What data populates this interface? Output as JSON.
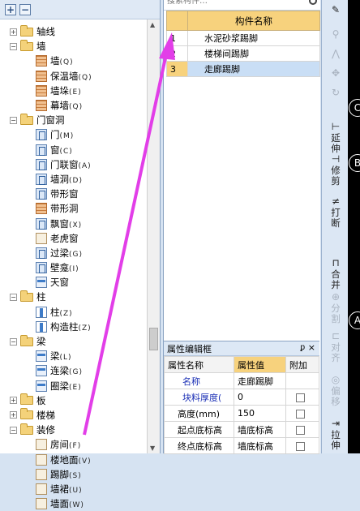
{
  "tree": {
    "add_label": "+",
    "remove_label": "−",
    "nodes": [
      {
        "label": "轴线",
        "type": "folder",
        "expander": "▹",
        "level": 0
      },
      {
        "label": "墙",
        "type": "folder-open",
        "expander": "◢",
        "level": 0
      },
      {
        "label": "墙",
        "key": "(Q)",
        "type": "wall",
        "level": 1
      },
      {
        "label": "保温墙",
        "key": "(Q)",
        "type": "wall",
        "level": 1
      },
      {
        "label": "墙垛",
        "key": "(E)",
        "type": "wall",
        "level": 1
      },
      {
        "label": "幕墙",
        "key": "(Q)",
        "type": "wall",
        "level": 1
      },
      {
        "label": "门窗洞",
        "type": "folder-open",
        "expander": "◢",
        "level": 0
      },
      {
        "label": "门",
        "key": "(M)",
        "type": "door",
        "level": 1
      },
      {
        "label": "窗",
        "key": "(C)",
        "type": "door",
        "level": 1
      },
      {
        "label": "门联窗",
        "key": "(A)",
        "type": "door",
        "level": 1
      },
      {
        "label": "墙洞",
        "key": "(D)",
        "type": "door",
        "level": 1
      },
      {
        "label": "带形窗",
        "key": "",
        "type": "door",
        "level": 1
      },
      {
        "label": "带形洞",
        "key": "",
        "type": "wall",
        "level": 1
      },
      {
        "label": "飘窗",
        "key": "(X)",
        "type": "door",
        "level": 1
      },
      {
        "label": "老虎窗",
        "key": "",
        "type": "room",
        "level": 1
      },
      {
        "label": "过梁",
        "key": "(G)",
        "type": "door",
        "level": 1
      },
      {
        "label": "壁龛",
        "key": "(I)",
        "type": "door",
        "level": 1
      },
      {
        "label": "天窗",
        "key": "",
        "type": "beam",
        "level": 1
      },
      {
        "label": "柱",
        "type": "folder-open",
        "expander": "◢",
        "level": 0
      },
      {
        "label": "柱",
        "key": "(Z)",
        "type": "col",
        "level": 1
      },
      {
        "label": "构造柱",
        "key": "(Z)",
        "type": "col",
        "level": 1
      },
      {
        "label": "梁",
        "type": "folder-open",
        "expander": "◢",
        "level": 0
      },
      {
        "label": "梁",
        "key": "(L)",
        "type": "beam",
        "level": 1
      },
      {
        "label": "连梁",
        "key": "(G)",
        "type": "beam",
        "level": 1
      },
      {
        "label": "圈梁",
        "key": "(E)",
        "type": "beam",
        "level": 1
      },
      {
        "label": "板",
        "type": "folder",
        "expander": "▹",
        "level": 0
      },
      {
        "label": "楼梯",
        "type": "folder",
        "expander": "▹",
        "level": 0
      },
      {
        "label": "装修",
        "type": "folder-open",
        "expander": "◢",
        "level": 0
      },
      {
        "label": "房间",
        "key": "(F)",
        "type": "room",
        "level": 1
      },
      {
        "label": "楼地面",
        "key": "(V)",
        "type": "room",
        "level": 1
      },
      {
        "label": "踢脚",
        "key": "(S)",
        "type": "room",
        "level": 1
      },
      {
        "label": "墙裙",
        "key": "(U)",
        "type": "room",
        "level": 1
      },
      {
        "label": "墙面",
        "key": "(W)",
        "type": "room",
        "level": 1
      }
    ]
  },
  "search": {
    "placeholder": "搜索构件…"
  },
  "grid": {
    "header": "构件名称",
    "rows": [
      {
        "num": "1",
        "name": "水泥砂浆踢脚"
      },
      {
        "num": "2",
        "name": "楼梯间踢脚"
      },
      {
        "num": "3",
        "name": "走廊踢脚"
      }
    ],
    "selected_row": 3
  },
  "props": {
    "title": "属性编辑框",
    "pin": "ᵱ",
    "close": "×",
    "headers": [
      "属性名称",
      "属性值",
      "附加"
    ],
    "rows": [
      {
        "name": "名称",
        "value": "走廊踢脚",
        "color": "blue",
        "checkbox": false
      },
      {
        "name": "块料厚度(",
        "value": "0",
        "color": "blue",
        "checkbox": true
      },
      {
        "name": "高度(mm)",
        "value": "150",
        "color": "black",
        "checkbox": true
      },
      {
        "name": "起点底标高",
        "value": "墙底标高",
        "color": "black",
        "checkbox": true
      },
      {
        "name": "终点底标高",
        "value": "墙底标高",
        "color": "black",
        "checkbox": true
      }
    ]
  },
  "toolbar": {
    "tools": [
      {
        "label": "",
        "icon": "✎",
        "dim": false
      },
      {
        "label": "",
        "icon": "⚲",
        "dim": true
      },
      {
        "label": "",
        "icon": "⋀",
        "dim": true
      },
      {
        "label": "",
        "icon": "✥",
        "dim": true
      },
      {
        "label": "",
        "icon": "↻",
        "dim": true
      },
      {
        "label": "延伸",
        "icon": "⊢",
        "dim": false
      },
      {
        "label": "修剪",
        "icon": "⊣",
        "dim": false
      },
      {
        "label": "打断",
        "icon": "≠",
        "dim": false
      },
      {
        "label": "合并",
        "icon": "⊓",
        "dim": false
      },
      {
        "label": "分割",
        "icon": "⊕",
        "dim": true
      },
      {
        "label": "对齐",
        "icon": "⊏",
        "dim": true
      },
      {
        "label": "偏移",
        "icon": "◎",
        "dim": true
      },
      {
        "label": "拉伸",
        "icon": "⇥",
        "dim": false
      }
    ],
    "markers": [
      "C",
      "B",
      "A"
    ]
  }
}
